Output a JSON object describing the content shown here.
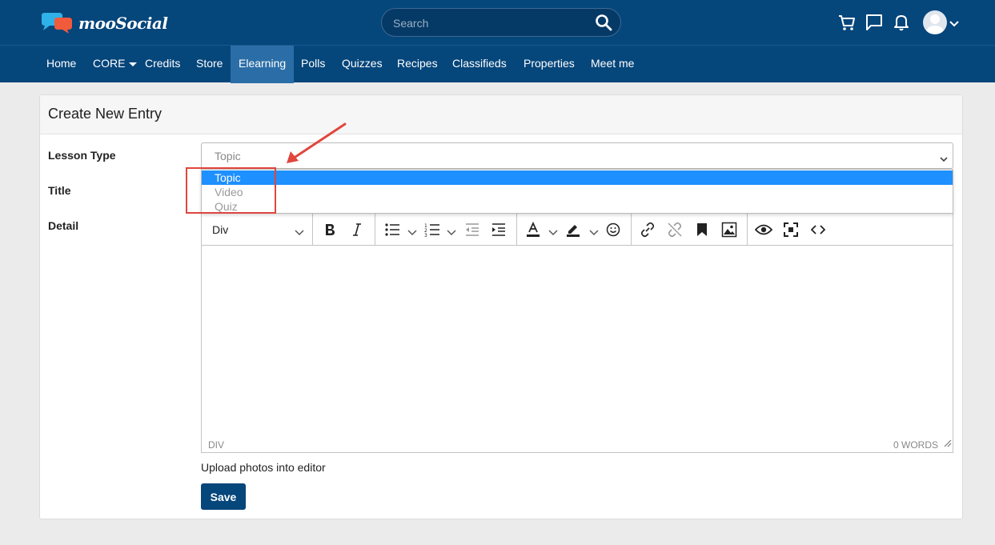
{
  "brand": {
    "name": "mooSocial"
  },
  "search": {
    "placeholder": "Search"
  },
  "header_icons": [
    "cart-icon",
    "chat-icon",
    "bell-icon",
    "avatar-icon",
    "chevron-down-icon"
  ],
  "nav": {
    "items": [
      {
        "label": "Home"
      },
      {
        "label": "CORE"
      },
      {
        "label": "Credits"
      },
      {
        "label": "Store"
      },
      {
        "label": "Elearning"
      },
      {
        "label": "Polls"
      },
      {
        "label": "Quizzes"
      },
      {
        "label": "Recipes"
      },
      {
        "label": "Classifieds"
      },
      {
        "label": "Properties"
      },
      {
        "label": "Meet me"
      }
    ],
    "active": "Elearning"
  },
  "form": {
    "title": "Create New Entry",
    "labels": {
      "lesson_type": "Lesson Type",
      "title": "Title",
      "detail": "Detail"
    },
    "lesson_type": {
      "value": "Topic",
      "options": [
        "Topic",
        "Video",
        "Quiz"
      ],
      "highlighted": "Topic"
    },
    "editor": {
      "block_format": "Div",
      "status_path": "DIV",
      "word_count": "0 WORDS"
    },
    "upload_text": "Upload photos into editor",
    "save_label": "Save"
  },
  "colors": {
    "header_bg": "#05467b",
    "nav_active_bg": "#2b6ea7",
    "selection_bg": "#1e90ff",
    "annotation": "#e0463e"
  }
}
